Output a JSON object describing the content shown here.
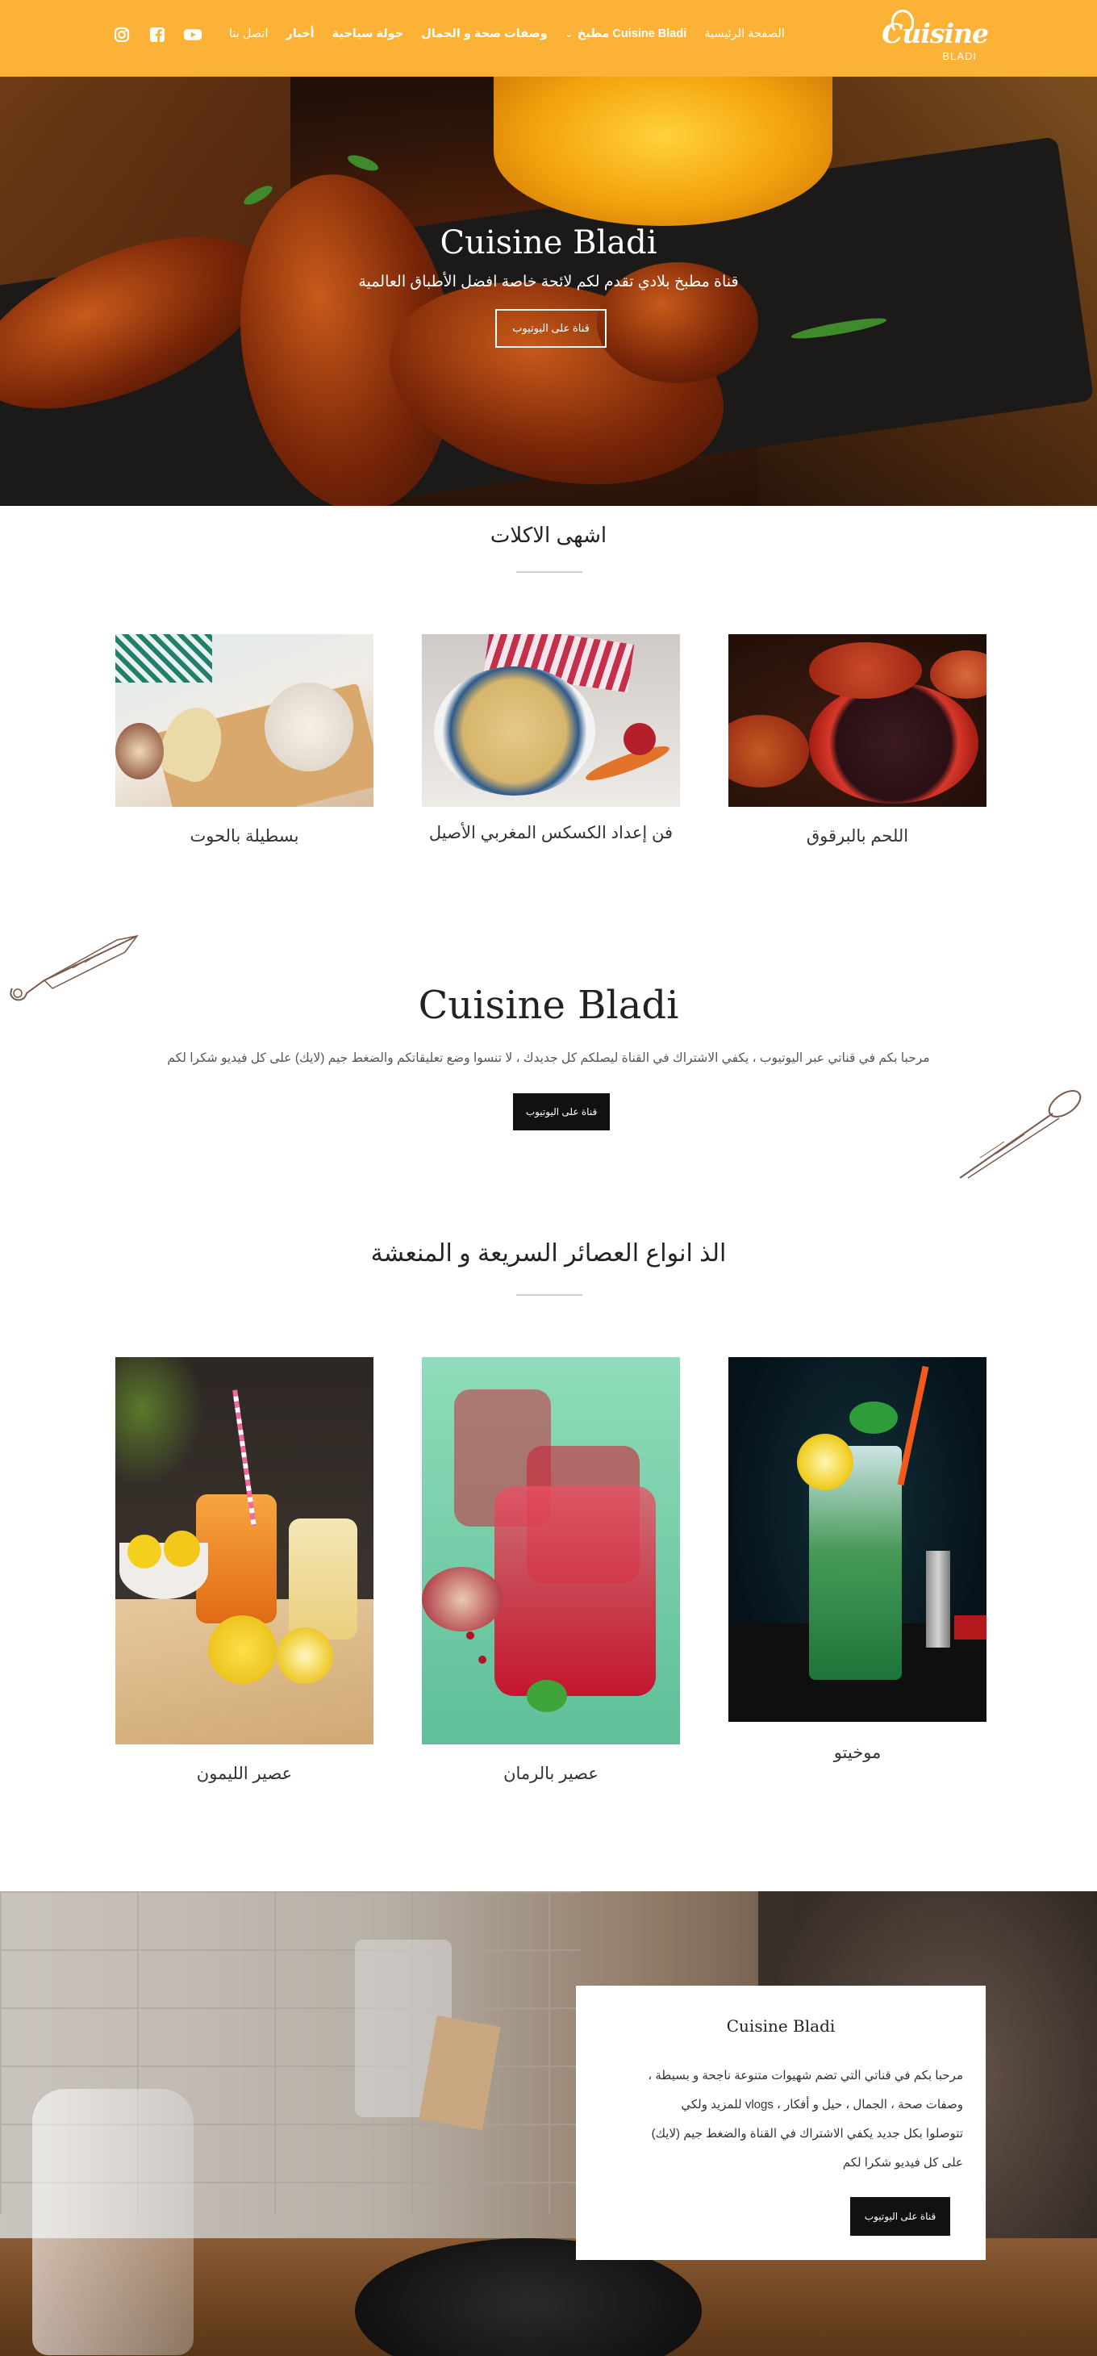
{
  "nav": {
    "menu": [
      {
        "label": "اتصل بنا",
        "bold": false
      },
      {
        "label": "أخبار",
        "bold": true
      },
      {
        "label": "جولة سياحية",
        "bold": true
      },
      {
        "label": "وصفات صحة و الجمال",
        "bold": true
      },
      {
        "label": "مطبخ Cuisine Bladi",
        "bold": true,
        "dropdown": true
      },
      {
        "label": "الصفحة الرئيسية",
        "bold": false
      }
    ],
    "social": [
      "instagram-icon",
      "facebook-icon",
      "youtube-icon"
    ],
    "logo": {
      "main": "Cuisine",
      "sub": "BLADI"
    }
  },
  "hero": {
    "title": "Cuisine Bladi",
    "subtitle": "قناة مطبخ بلادي تقدم لكم لائحة خاصة افضل الأطباق العالمية",
    "button": "قناة على اليوتيوب"
  },
  "section_meals": {
    "title": "اشهى الاكلات",
    "cards": [
      {
        "label": "بسطيلة بالحوت"
      },
      {
        "label": "فن إعداد الكسكس المغربي الأصيل"
      },
      {
        "label": "اللحم بالبرقوق"
      }
    ]
  },
  "intro": {
    "title": "Cuisine Bladi",
    "text": "مرحبا بكم في قناتي عبر اليوتيوب ، يكفي الاشتراك في القناة ليصلكم كل جديدك ، لا تنسوا وضع تعليقاتكم والضغط جيم (لايك) على كل فيديو شكرا لكم",
    "button": "قناة على اليوتيوب"
  },
  "section_juices": {
    "title": "الذ انواع العصائر  السريعة و المنعشة",
    "cards": [
      {
        "label": "عصير الليمون"
      },
      {
        "label": "عصير بالرمان"
      },
      {
        "label": "موخيتو"
      }
    ]
  },
  "about": {
    "title": "Cuisine Bladi",
    "lines": [
      "مرحبا بكم في قناتي التي تضم شهيوات متنوعة ناجحة و بسيطة ،",
      "وصفات صحة ، الجمال ، حيل و أفكار ، vlogs للمزيد ولكي",
      "تتوصلوا بكل جديد يكفي الاشتراك في القناة والضغط جيم (لايك)",
      "على كل فيديو شكرا لكم"
    ],
    "button": "قناة على اليوتيوب"
  },
  "colors": {
    "accent": "#fbb236",
    "dark": "#111111"
  }
}
